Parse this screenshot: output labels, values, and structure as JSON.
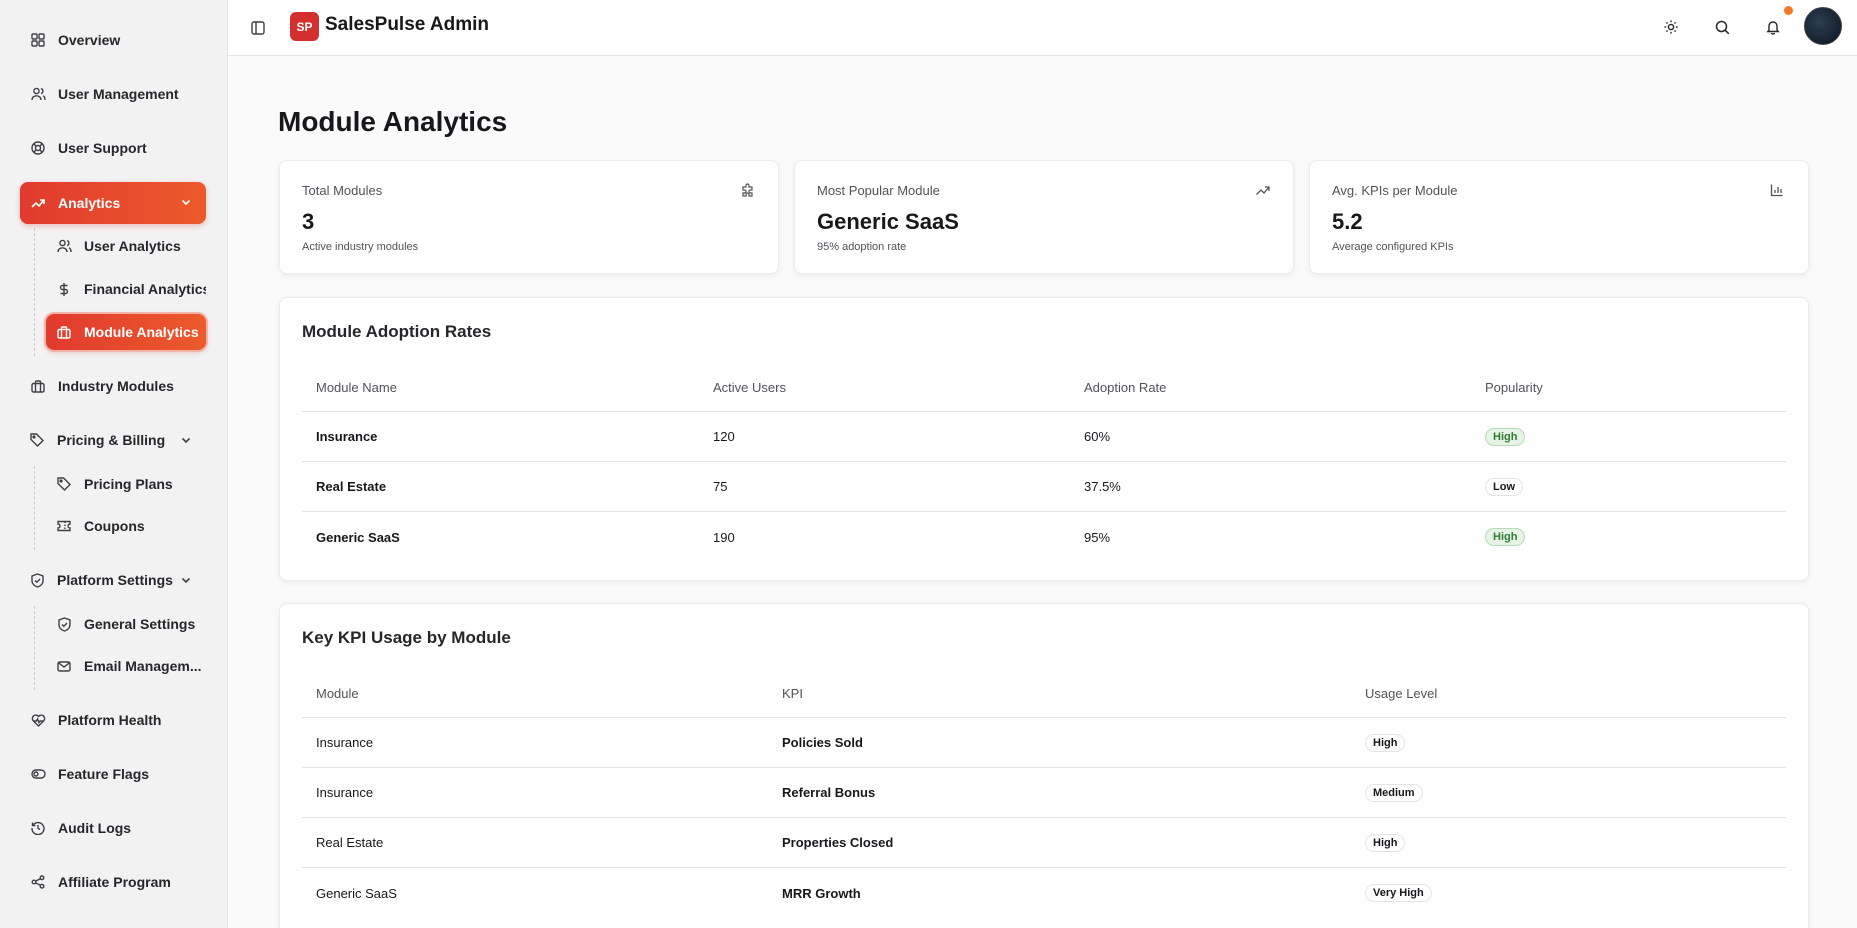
{
  "sidebar": {
    "items": [
      {
        "label": "Overview",
        "icon": "grid-icon"
      },
      {
        "label": "User Management",
        "icon": "users-icon"
      },
      {
        "label": "User Support",
        "icon": "lifebuoy-icon"
      },
      {
        "label": "Analytics",
        "icon": "trending-up-icon"
      },
      {
        "label": "Industry Modules",
        "icon": "briefcase-icon"
      },
      {
        "label": "Pricing & Billing",
        "icon": "tag-icon"
      },
      {
        "label": "Platform Settings",
        "icon": "shield-icon"
      },
      {
        "label": "Platform Health",
        "icon": "heart-pulse-icon"
      },
      {
        "label": "Feature Flags",
        "icon": "toggle-icon"
      },
      {
        "label": "Audit Logs",
        "icon": "history-icon"
      },
      {
        "label": "Affiliate Program",
        "icon": "share-icon"
      }
    ],
    "analytics_sub": [
      {
        "label": "User Analytics",
        "icon": "users-icon"
      },
      {
        "label": "Financial Analytics",
        "icon": "dollar-icon"
      },
      {
        "label": "Module Analytics",
        "icon": "briefcase-icon"
      }
    ],
    "pricing_sub": [
      {
        "label": "Pricing Plans",
        "icon": "tag-icon"
      },
      {
        "label": "Coupons",
        "icon": "ticket-icon"
      }
    ],
    "settings_sub": [
      {
        "label": "General Settings",
        "icon": "shield-icon"
      },
      {
        "label": "Email Managem...",
        "icon": "mail-icon"
      }
    ]
  },
  "header": {
    "logo_text": "SP",
    "app_title": "SalesPulse Admin"
  },
  "main": {
    "page_title": "Module Analytics",
    "stats": [
      {
        "label": "Total Modules",
        "value": "3",
        "sub": "Active industry modules",
        "icon": "puzzle-icon"
      },
      {
        "label": "Most Popular Module",
        "value": "Generic SaaS",
        "sub": "95% adoption rate",
        "icon": "trending-up-icon"
      },
      {
        "label": "Avg. KPIs per Module",
        "value": "5.2",
        "sub": "Average configured KPIs",
        "icon": "bar-chart-icon"
      }
    ],
    "adoption": {
      "title": "Module Adoption Rates",
      "headers": [
        "Module Name",
        "Active Users",
        "Adoption Rate",
        "Popularity"
      ],
      "rows": [
        {
          "name": "Insurance",
          "users": "120",
          "rate": "60%",
          "popularity": "High"
        },
        {
          "name": "Real Estate",
          "users": "75",
          "rate": "37.5%",
          "popularity": "Low"
        },
        {
          "name": "Generic SaaS",
          "users": "190",
          "rate": "95%",
          "popularity": "High"
        }
      ]
    },
    "kpi": {
      "title": "Key KPI Usage by Module",
      "headers": [
        "Module",
        "KPI",
        "Usage Level"
      ],
      "rows": [
        {
          "module": "Insurance",
          "kpi": "Policies Sold",
          "level": "High"
        },
        {
          "module": "Insurance",
          "kpi": "Referral Bonus",
          "level": "Medium"
        },
        {
          "module": "Real Estate",
          "kpi": "Properties Closed",
          "level": "High"
        },
        {
          "module": "Generic SaaS",
          "kpi": "MRR Growth",
          "level": "Very High"
        }
      ]
    }
  }
}
